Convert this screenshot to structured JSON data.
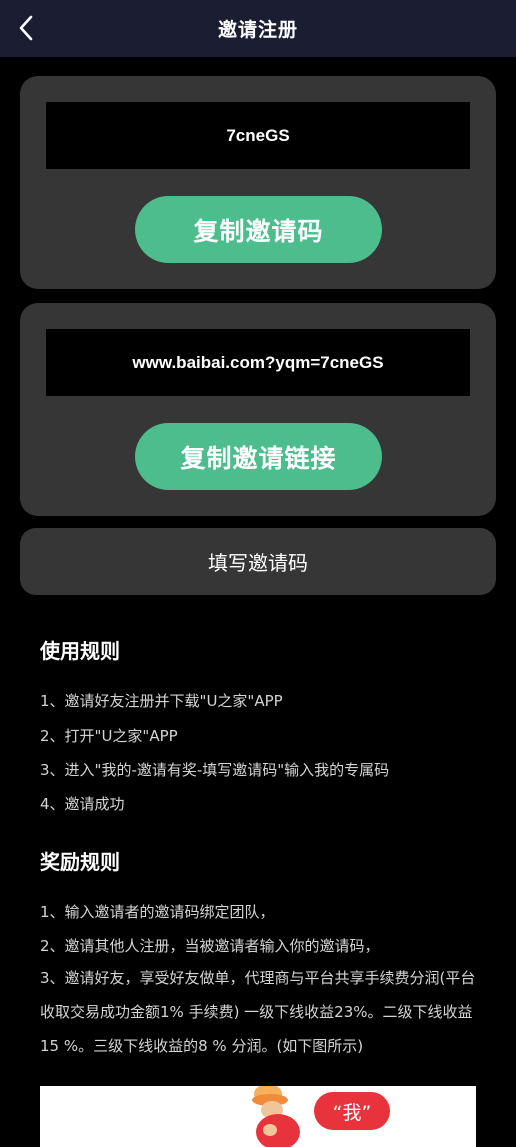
{
  "header": {
    "title": "邀请注册"
  },
  "invite_code_card": {
    "code": "7cneGS",
    "copy_button": "复制邀请码"
  },
  "invite_link_card": {
    "link": "www.baibai.com?yqm=7cneGS",
    "copy_button": "复制邀请链接"
  },
  "fill_button": {
    "label": "填写邀请码"
  },
  "usage_rules": {
    "title": "使用规则",
    "items": [
      "1、邀请好友注册并下载\"U之家\"APP",
      "2、打开\"U之家\"APP",
      "3、进入\"我的-邀请有奖-填写邀请码\"输入我的专属码",
      "4、邀请成功"
    ]
  },
  "reward_rules": {
    "title": "奖励规则",
    "items": [
      "1、输入邀请者的邀请码绑定团队，",
      "2、邀请其他人注册，当被邀请者输入你的邀请码，",
      "3、邀请好友，享受好友做单，代理商与平台共享手续费分润(平台收取交易成功金额1% 手续费) 一级下线收益23%。二级下线收益15 %。三级下线收益的8 % 分润。(如下图所示)"
    ]
  },
  "banner": {
    "bubble_text": "“我”"
  },
  "colors": {
    "header_bg": "#1b1d33",
    "card_bg": "#363636",
    "accent_green": "#4dbd8e",
    "bubble_red": "#e8323c"
  }
}
